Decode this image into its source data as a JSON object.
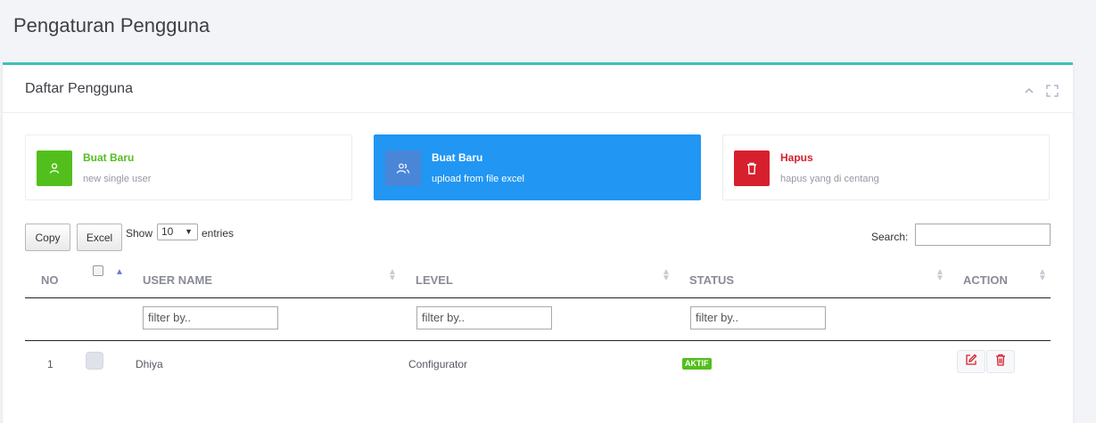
{
  "page": {
    "title": "Pengaturan Pengguna"
  },
  "portlet": {
    "title": "Daftar Pengguna"
  },
  "cards": {
    "new": {
      "title": "Buat Baru",
      "subtitle": "new single user"
    },
    "upload": {
      "title": "Buat Baru",
      "subtitle": "upload from file excel"
    },
    "delete": {
      "title": "Hapus",
      "subtitle": "hapus yang di centang"
    }
  },
  "toolbar": {
    "copy_label": "Copy",
    "excel_label": "Excel",
    "show_label": "Show",
    "entries_value": "10",
    "entries_label": "entries",
    "search_label": "Search:"
  },
  "table": {
    "columns": [
      "NO",
      "USER NAME",
      "LEVEL",
      "STATUS",
      "ACTION"
    ],
    "filter_placeholder": "filter by..",
    "rows": [
      {
        "no": "1",
        "username": "Dhiya",
        "level": "Configurator",
        "status": "AKTIF"
      }
    ]
  },
  "colors": {
    "accent": "#3ac2b9",
    "green": "#53bf1c",
    "blue": "#2196f3",
    "red": "#d6202e"
  },
  "icons": [
    "user-icon",
    "users-icon",
    "trash-icon",
    "chevron-up-icon",
    "fullscreen-icon",
    "edit-icon"
  ]
}
